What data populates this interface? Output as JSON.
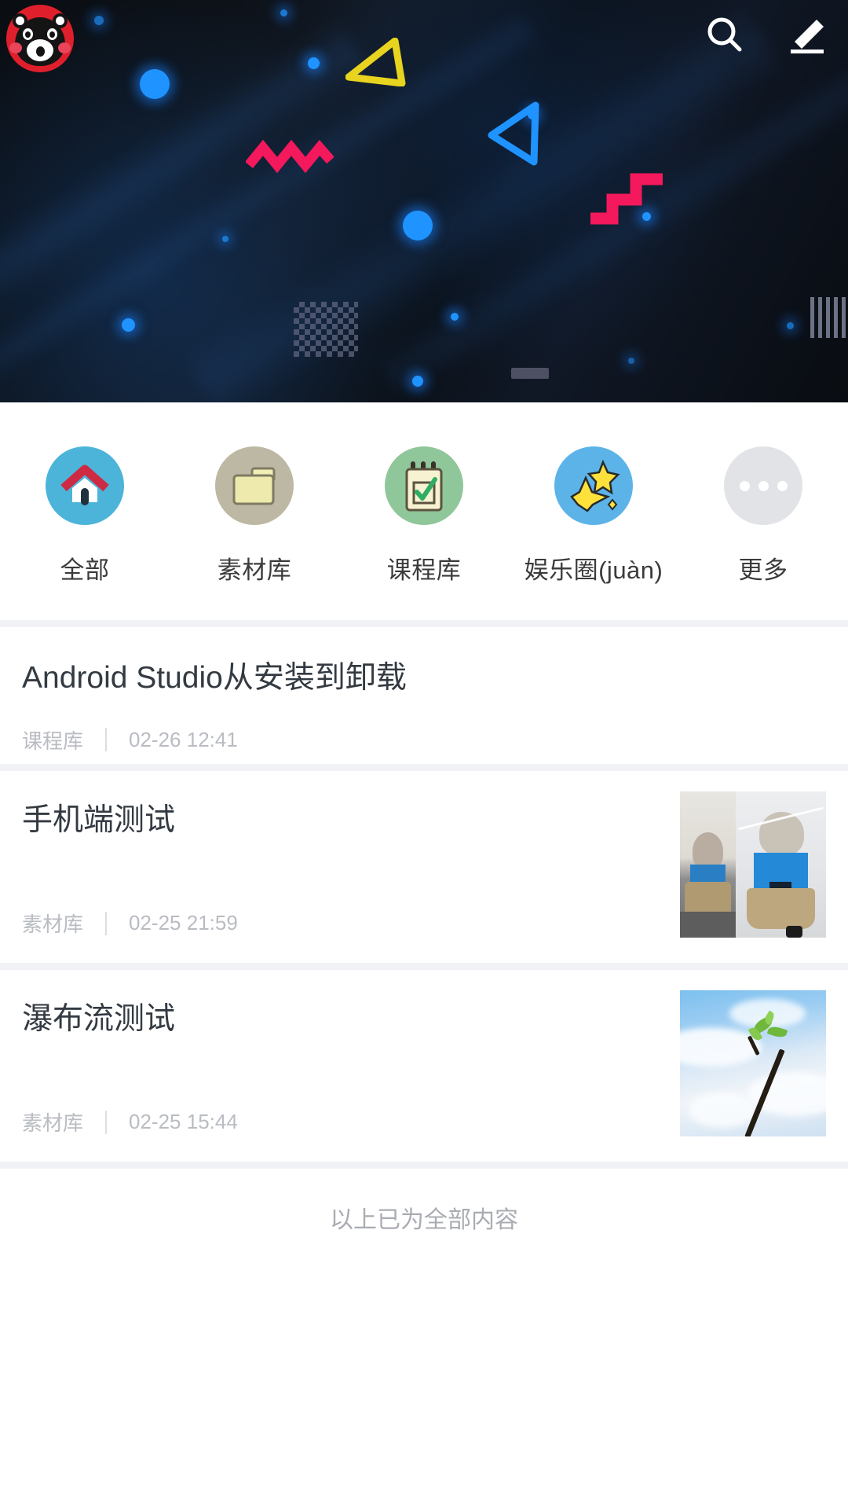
{
  "header": {
    "avatar_name": "kumamon-avatar",
    "search_icon": "search-icon",
    "edit_icon": "pencil-edit-icon",
    "banner_decorations": [
      "yellow-triangle-outline",
      "blue-left-triangle-outline",
      "pink-zigzag",
      "pink-staircase",
      "gray-checkerboard",
      "gray-bars",
      "gray-plate",
      "blue-glow-dots"
    ]
  },
  "categories": [
    {
      "label": "全部",
      "icon": "home-icon",
      "color": "#4cb4d9"
    },
    {
      "label": "素材库",
      "icon": "folder-icon",
      "color": "#bdb8a4"
    },
    {
      "label": "课程库",
      "icon": "notebook-check-icon",
      "color": "#8fc79a"
    },
    {
      "label": "娱乐圈(juàn)",
      "icon": "star-icon",
      "color": "#5cb3e8"
    },
    {
      "label": "更多",
      "icon": "more-dots-icon",
      "color": "#e2e3e6"
    }
  ],
  "articles": [
    {
      "title": "Android Studio从安装到卸载",
      "category": "课程库",
      "date": "02-26 12:41",
      "thumbnail": null
    },
    {
      "title": "手机端测试",
      "category": "素材库",
      "date": "02-25 21:59",
      "thumbnail": "cat-costume-photo"
    },
    {
      "title": "瀑布流测试",
      "category": "素材库",
      "date": "02-25 15:44",
      "thumbnail": "sky-branch-sprout-photo"
    }
  ],
  "footer": {
    "end_text": "以上已为全部内容"
  },
  "colors": {
    "banner_dark": "#0b1017",
    "accent_blue": "#1f93ff",
    "accent_yellow": "#e8d41f",
    "accent_pink": "#f4185c",
    "separator": "#f1f2f6",
    "title_text": "#333a42",
    "meta_text": "#b9bcc2"
  }
}
